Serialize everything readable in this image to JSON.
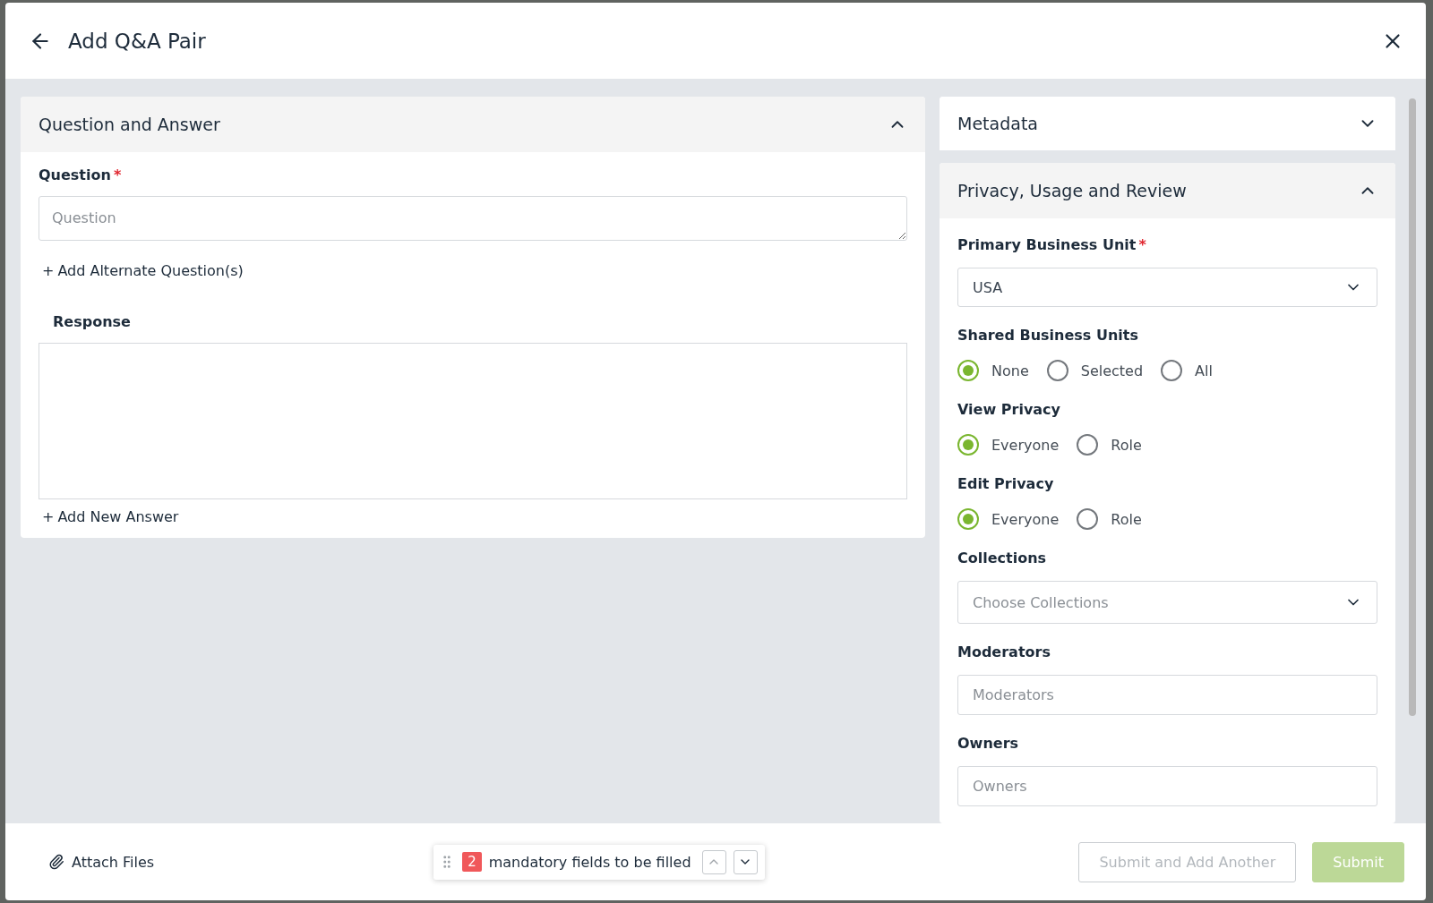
{
  "dialog": {
    "title": "Add Q&A Pair"
  },
  "qa_section": {
    "title": "Question and Answer",
    "expanded": true,
    "question": {
      "label": "Question",
      "required_mark": "*",
      "placeholder": "Question"
    },
    "add_alternate": {
      "icon": "+",
      "label": "Add Alternate Question(s)"
    },
    "response": {
      "label": "Response"
    },
    "add_answer": {
      "icon": "+",
      "label": "Add New Answer"
    }
  },
  "metadata_section": {
    "title": "Metadata",
    "expanded": false
  },
  "privacy_section": {
    "title": "Privacy, Usage and Review",
    "expanded": true,
    "fields": [
      {
        "kind": "select",
        "label": "Primary Business Unit",
        "required_mark": "*",
        "value": "USA"
      },
      {
        "kind": "radio",
        "label": "Shared Business Units",
        "options": [
          {
            "label": "None",
            "selected": true
          },
          {
            "label": "Selected",
            "selected": false
          },
          {
            "label": "All",
            "selected": false
          }
        ]
      },
      {
        "kind": "radio",
        "label": "View Privacy",
        "options": [
          {
            "label": "Everyone",
            "selected": true
          },
          {
            "label": "Role",
            "selected": false
          }
        ]
      },
      {
        "kind": "radio",
        "label": "Edit Privacy",
        "options": [
          {
            "label": "Everyone",
            "selected": true
          },
          {
            "label": "Role",
            "selected": false
          }
        ]
      },
      {
        "kind": "select",
        "label": "Collections",
        "placeholder": "Choose Collections"
      },
      {
        "kind": "text",
        "label": "Moderators",
        "placeholder": "Moderators"
      },
      {
        "kind": "text",
        "label": "Owners",
        "placeholder": "Owners"
      }
    ]
  },
  "footer": {
    "attach": "Attach Files",
    "mandatory_count": "2",
    "mandatory_text": "mandatory fields to be filled",
    "buttons": [
      {
        "kind": "secondary",
        "label": "Submit and Add Another",
        "disabled": true
      },
      {
        "kind": "primary",
        "label": "Submit",
        "disabled": true
      }
    ]
  }
}
